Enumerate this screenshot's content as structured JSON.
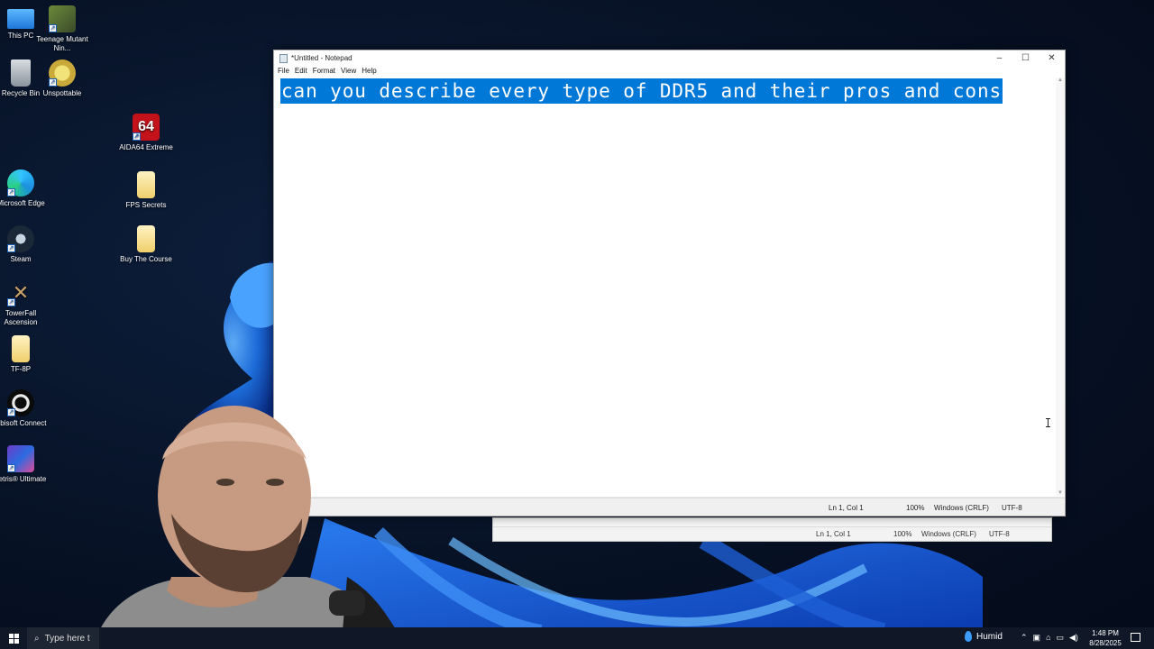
{
  "desktop": {
    "icons": [
      {
        "label": "This PC"
      },
      {
        "label": "Teenage Mutant Nin..."
      },
      {
        "label": "Recycle Bin"
      },
      {
        "label": "Unspottable"
      },
      {
        "label": "AIDA64 Extreme"
      },
      {
        "label": "FPS Secrets"
      },
      {
        "label": "Microsoft Edge"
      },
      {
        "label": "Buy The Course"
      },
      {
        "label": "Steam"
      },
      {
        "label": "TowerFall Ascension"
      },
      {
        "label": "TF-8P"
      },
      {
        "label": "Ubisoft Connect"
      },
      {
        "label": "Tetris® Ultimate"
      }
    ]
  },
  "notepad": {
    "title": "*Untitled - Notepad",
    "menu": [
      "File",
      "Edit",
      "Format",
      "View",
      "Help"
    ],
    "content": "can you describe every type of DDR5 and their pros and cons",
    "status": {
      "position": "Ln 1, Col 1",
      "zoom": "100%",
      "line_endings": "Windows (CRLF)",
      "encoding": "UTF-8"
    }
  },
  "notepad_back": {
    "status": {
      "position": "Ln 1, Col 1",
      "zoom": "100%",
      "line_endings": "Windows (CRLF)",
      "encoding": "UTF-8"
    }
  },
  "taskbar": {
    "search_placeholder": "Type here t",
    "weather": "Humid",
    "time": "1:48 PM",
    "date": "8/28/2025"
  },
  "colors": {
    "selection": "#0078d7",
    "taskbar": "#101827"
  }
}
